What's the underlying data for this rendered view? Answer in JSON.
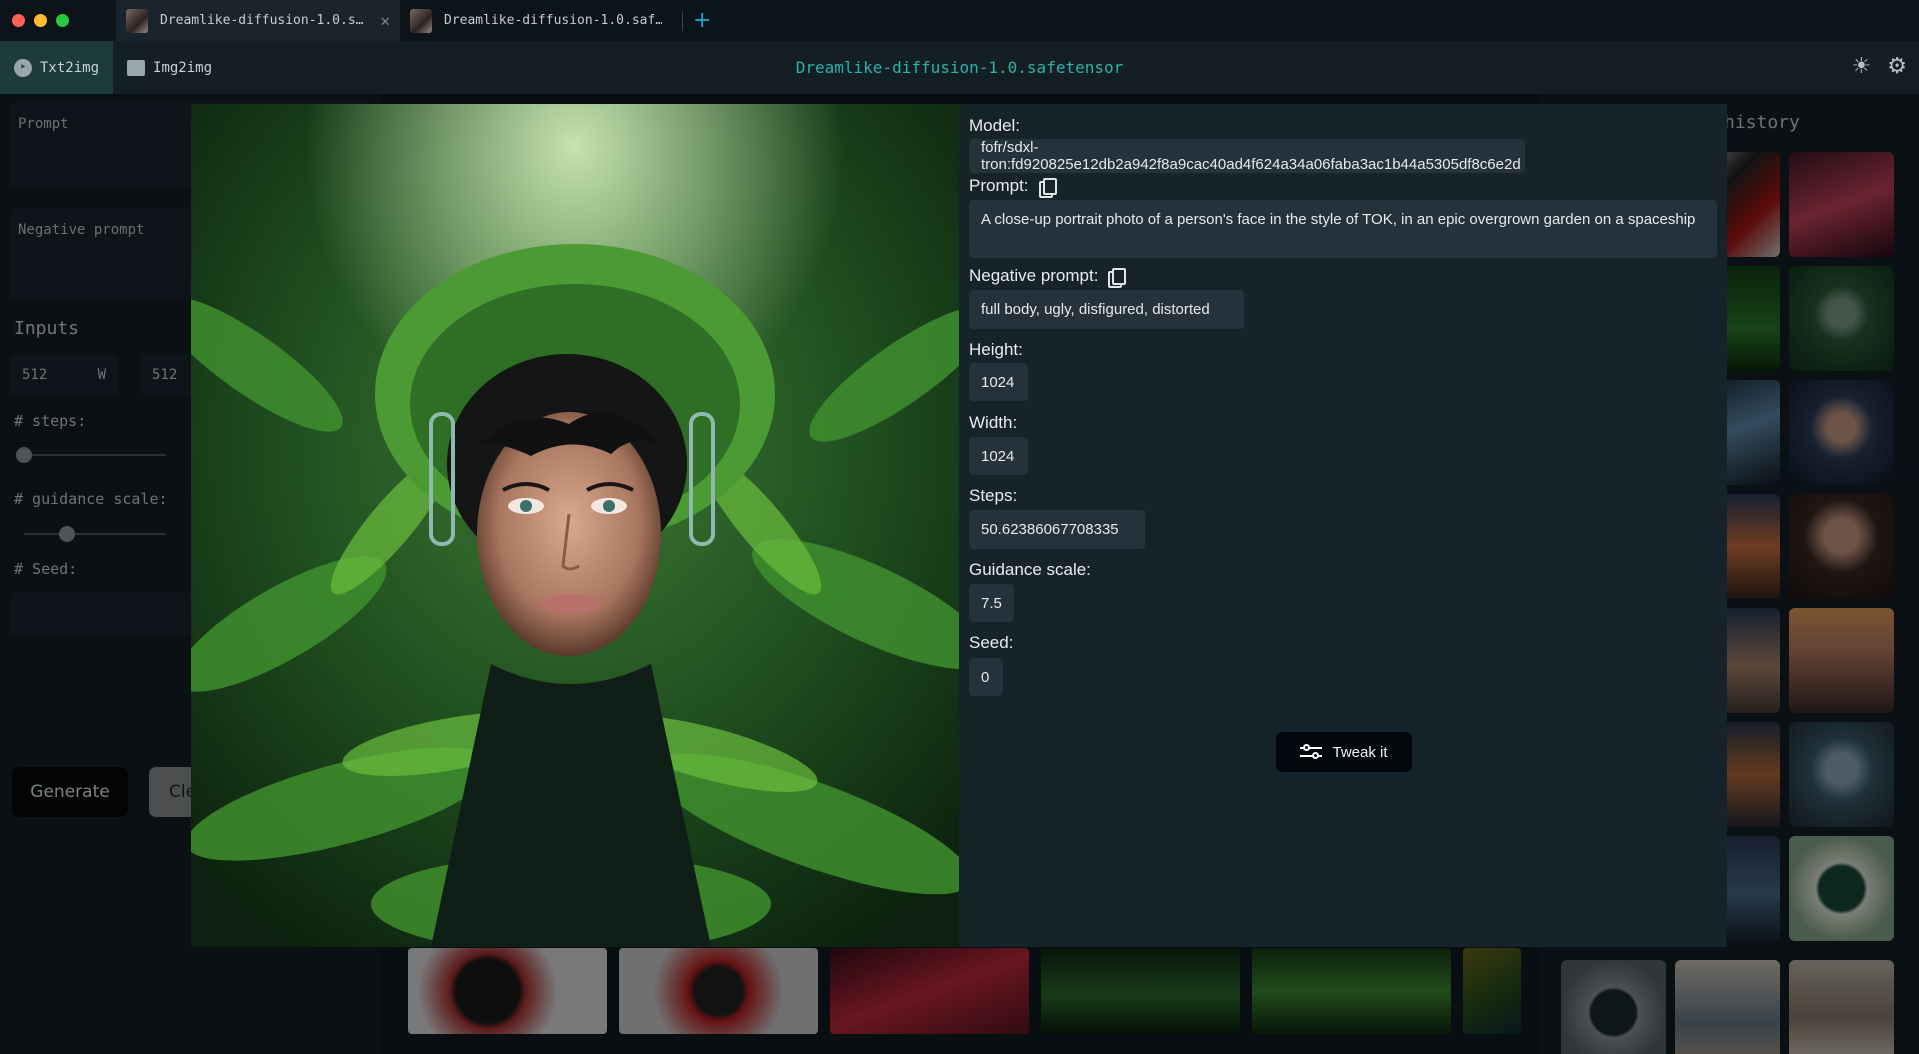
{
  "tabs": [
    {
      "label": "Dreamlike-diffusion-1.0.s…",
      "close": "✕"
    },
    {
      "label": "Dreamlike-diffusion-1.0.saf…"
    }
  ],
  "new_tab": "+",
  "modes": [
    {
      "label": "Txt2img"
    },
    {
      "label": "Img2img"
    }
  ],
  "app_title": "Dreamlike-diffusion-1.0.safetensor",
  "left": {
    "prompt_placeholder": "Prompt",
    "negative_placeholder": "Negative prompt",
    "inputs_heading": "Inputs",
    "width_value": "512",
    "width_unit": "W",
    "height_value": "512",
    "steps_label": "# steps:",
    "steps_fraction": 0.0,
    "guidance_label": "# guidance scale:",
    "guidance_fraction": 0.3,
    "seed_label": "# Seed:",
    "generate_label": "Generate",
    "clear_label": "Cle"
  },
  "history": {
    "title": "history"
  },
  "details": {
    "model_label": "Model:",
    "model_value": "fofr/sdxl-tron:fd920825e12db2a942f8a9cac40ad4f624a34a06faba3ac1b44a5305df8c6e2d",
    "prompt_label": "Prompt:",
    "prompt_value": "A close-up portrait photo of a person's face in the style of TOK, in an epic overgrown garden on a spaceship",
    "negative_label": "Negative prompt:",
    "negative_value": "full body, ugly, disfigured, distorted",
    "height_label": "Height:",
    "height_value": "1024",
    "width_label": "Width:",
    "width_value": "1024",
    "steps_label": "Steps:",
    "steps_value": "50.62386067708335",
    "guidance_label": "Guidance scale:",
    "guidance_value": "7.5",
    "seed_label": "Seed:",
    "seed_value": "0",
    "tweak_label": "Tweak it"
  },
  "colors": {
    "accent_teal": "#2ab3a6",
    "tab_plus": "#1aa6c9",
    "traffic_red": "#ff5f57",
    "traffic_yellow": "#febc2e",
    "traffic_green": "#28c840"
  }
}
